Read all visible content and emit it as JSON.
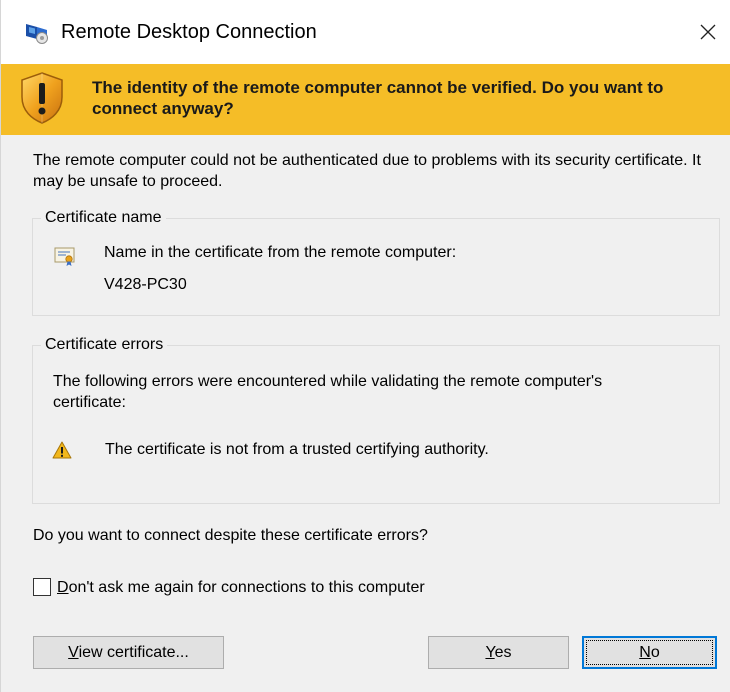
{
  "window": {
    "title": "Remote Desktop Connection",
    "close_glyph": "✕"
  },
  "banner": {
    "icon": "shield-warning-icon",
    "color": "#f5bd27",
    "message": "The identity of the remote computer cannot be verified. Do you want to connect anyway?"
  },
  "intro_text": "The remote computer could not be authenticated due to problems with its security certificate. It may be unsafe to proceed.",
  "certificate_name": {
    "label": "Certificate name",
    "icon": "certificate-icon",
    "line1": "Name in the certificate from the remote computer:",
    "value": "V428-PC30"
  },
  "certificate_errors": {
    "label": "Certificate errors",
    "intro": "The following errors were encountered while validating the remote computer's certificate:",
    "items": [
      {
        "icon": "warning-icon",
        "text": "The certificate is not from a trusted certifying authority."
      }
    ]
  },
  "question": "Do you want to connect despite these certificate errors?",
  "dont_ask": {
    "label_accel": "D",
    "label_rest": "on't ask me again for connections to this computer",
    "checked": false
  },
  "buttons": {
    "view_accel": "V",
    "view_rest": "iew certificate...",
    "yes_accel": "Y",
    "yes_rest": "es",
    "no_accel": "N",
    "no_rest": "o",
    "focus_color": "#0078d7"
  }
}
